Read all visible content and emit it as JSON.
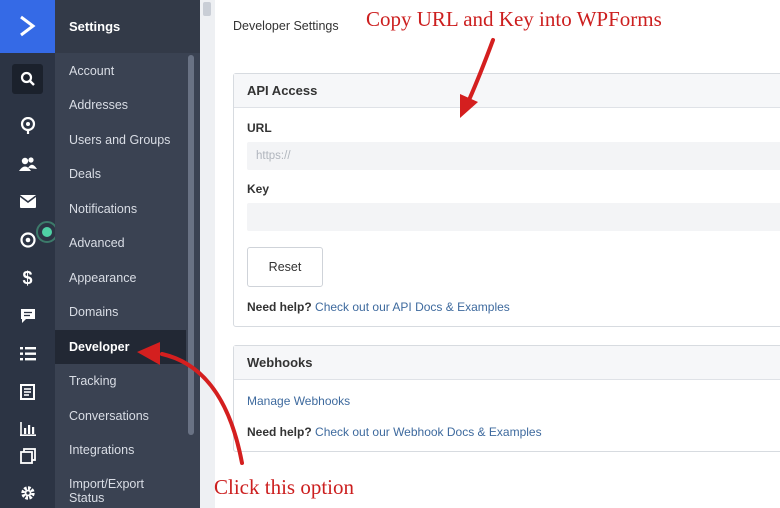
{
  "rail": {
    "icons": [
      "logo-chevron-icon",
      "search-icon",
      "location-pin-icon",
      "contacts-icon",
      "mail-icon",
      "target-icon",
      "dollar-icon",
      "chat-icon",
      "list-icon",
      "document-icon",
      "bar-chart-icon",
      "copy-icon",
      "gear-icon"
    ],
    "colors": {
      "logo_bg": "#356ae6",
      "rail_bg": "#2c3444",
      "status_dot": "#4fd1a5"
    }
  },
  "nav": {
    "title": "Settings",
    "items": [
      {
        "label": "Account"
      },
      {
        "label": "Addresses"
      },
      {
        "label": "Users and Groups"
      },
      {
        "label": "Deals"
      },
      {
        "label": "Notifications"
      },
      {
        "label": "Advanced"
      },
      {
        "label": "Appearance"
      },
      {
        "label": "Domains"
      },
      {
        "label": "Developer",
        "active": true
      },
      {
        "label": "Tracking"
      },
      {
        "label": "Conversations"
      },
      {
        "label": "Integrations"
      },
      {
        "label": "Import/Export Status"
      }
    ]
  },
  "main": {
    "title": "Developer Settings",
    "api_access": {
      "heading": "API Access",
      "url_label": "URL",
      "url_value": "https://",
      "key_label": "Key",
      "key_value": "",
      "reset_label": "Reset",
      "help_prefix": "Need help?",
      "help_link": "Check out our API Docs & Examples"
    },
    "webhooks": {
      "heading": "Webhooks",
      "manage_link": "Manage Webhooks",
      "help_prefix": "Need help?",
      "help_link": "Check out our Webhook Docs & Examples"
    }
  },
  "annotations": {
    "top_note": "Copy URL and Key into WPForms",
    "bottom_note": "Click this option",
    "color": "#cc1f1f"
  }
}
